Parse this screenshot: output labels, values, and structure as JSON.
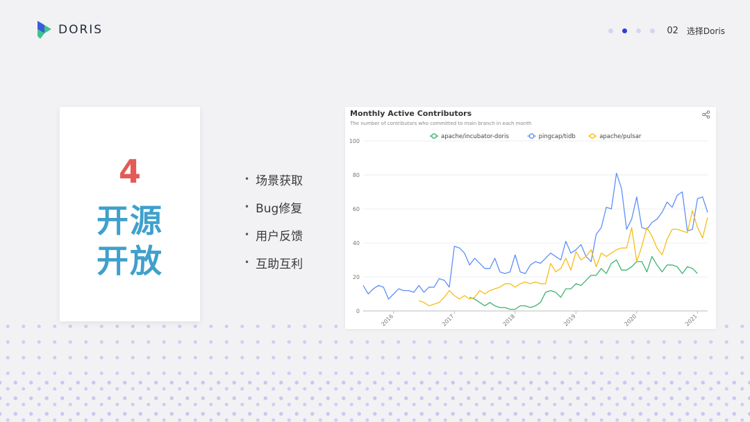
{
  "brand": {
    "name": "DORIS",
    "colors": {
      "logo_blue": "#3b5bdb",
      "logo_green": "#3cc48c"
    }
  },
  "pager": {
    "dots": [
      false,
      true,
      false,
      false
    ],
    "page_number": "02",
    "section_label": "选择Doris"
  },
  "card": {
    "number": "4",
    "line1": "开源",
    "line2": "开放"
  },
  "bullets": [
    "场景获取",
    "Bug修复",
    "用户反馈",
    "互助互利"
  ],
  "chart_widget": {
    "title": "Monthly Active Contributors",
    "subtitle": "The number of contributors who committed to main branch in each month",
    "share_icon": "share-icon"
  },
  "chart_data": {
    "type": "line",
    "title": "Monthly Active Contributors",
    "subtitle": "The number of contributors who committed to main branch in each month",
    "ylim": [
      0,
      100
    ],
    "yticks": [
      0,
      20,
      40,
      60,
      80,
      100
    ],
    "x_ticks": [
      "2016",
      "2017",
      "2018",
      "2019",
      "2020",
      "2021"
    ],
    "x_start": 2015.5,
    "x_step": 0.0833,
    "legend_position": "top-center",
    "grid": "horizontal",
    "series": [
      {
        "name": "apache/incubator-doris",
        "color": "#3cb371",
        "start_index": 21,
        "values": [
          8,
          7,
          5,
          3,
          5,
          3,
          2,
          2,
          1,
          1,
          3,
          3,
          2,
          3,
          5,
          11,
          12,
          11,
          8,
          13,
          13,
          16,
          15,
          18,
          21,
          21,
          25,
          22,
          28,
          30,
          24,
          24,
          26,
          29,
          29,
          23,
          32,
          27,
          23,
          27,
          27,
          26,
          22,
          26,
          25,
          22
        ]
      },
      {
        "name": "pingcap/tidb",
        "color": "#5b8ff9",
        "start_index": 0,
        "values": [
          15,
          10,
          13,
          15,
          14,
          7,
          10,
          13,
          12,
          12,
          11,
          15,
          11,
          14,
          14,
          19,
          18,
          14,
          38,
          37,
          34,
          27,
          31,
          28,
          25,
          25,
          31,
          23,
          22,
          23,
          33,
          23,
          22,
          27,
          29,
          28,
          31,
          34,
          32,
          30,
          41,
          34,
          36,
          39,
          32,
          29,
          45,
          49,
          61,
          60,
          81,
          72,
          48,
          54,
          67,
          49,
          48,
          52,
          54,
          58,
          64,
          61,
          68,
          70,
          47,
          48,
          66,
          67,
          58
        ]
      },
      {
        "name": "apache/pulsar",
        "color": "#f6bd16",
        "start_index": 11,
        "values": [
          6,
          5,
          3,
          4,
          5,
          8,
          12,
          9,
          7,
          9,
          7,
          8,
          12,
          10,
          12,
          13,
          14,
          16,
          16,
          14,
          16,
          17,
          16,
          17,
          16,
          16,
          28,
          23,
          25,
          31,
          24,
          35,
          30,
          32,
          36,
          26,
          34,
          32,
          34,
          36,
          37,
          37,
          49,
          29,
          38,
          49,
          44,
          37,
          33,
          42,
          48,
          48,
          47,
          46,
          59,
          49,
          43,
          55
        ]
      }
    ]
  }
}
